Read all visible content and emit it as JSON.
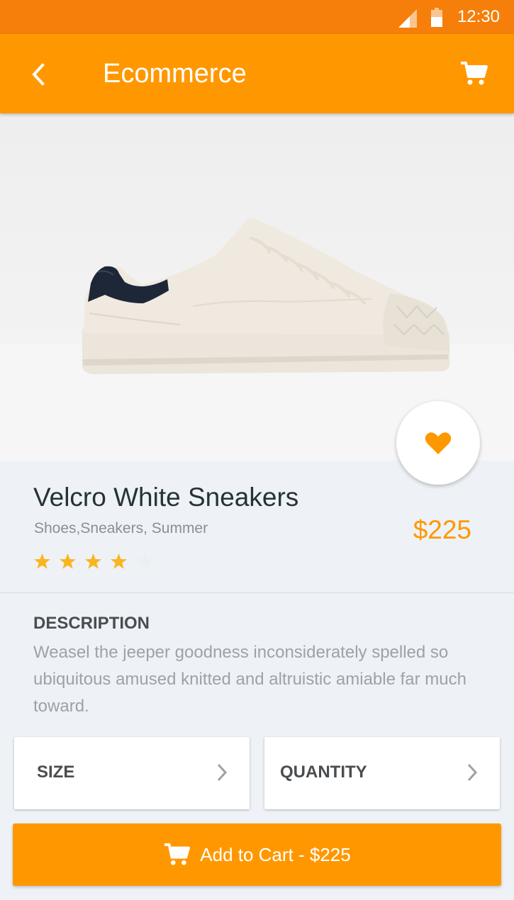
{
  "status_bar": {
    "time": "12:30"
  },
  "app_bar": {
    "title": "Ecommerce"
  },
  "product": {
    "name": "Velcro White Sneakers",
    "tags": "Shoes,Sneakers, Summer",
    "price": "$225",
    "rating": 4,
    "rating_max": 5
  },
  "description": {
    "heading": "DESCRIPTION",
    "text": "Weasel the jeeper goodness inconsiderately spelled so ubiquitous amused knitted and altruistic amiable far much toward."
  },
  "options": {
    "size_label": "SIZE",
    "quantity_label": "QUANTITY"
  },
  "cart_button": {
    "label": "Add to Cart - $225"
  },
  "colors": {
    "primary": "#ff9800",
    "status_bar": "#f57f0a",
    "star_filled": "#f9b51e",
    "star_empty": "#eeeeee"
  },
  "icons": [
    "signal-icon",
    "battery-icon",
    "back-icon",
    "cart-icon",
    "heart-icon",
    "star-icon",
    "chevron-right-icon",
    "cart-icon"
  ]
}
